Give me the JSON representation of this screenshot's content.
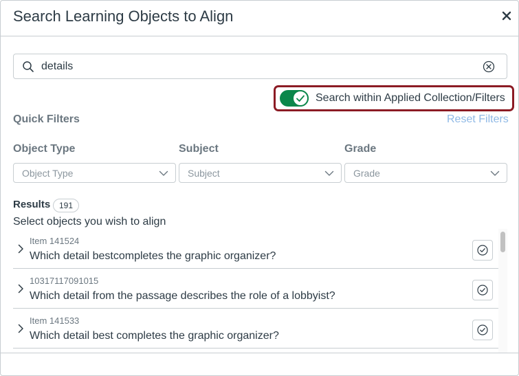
{
  "modal": {
    "title": "Search Learning Objects to Align",
    "close_icon": "close-icon"
  },
  "search": {
    "value": "details",
    "placeholder": "",
    "icon": "search-icon",
    "clear_icon": "clear-circle-icon"
  },
  "toggle": {
    "label": "Search within Applied Collection/Filters",
    "checked": true,
    "on_color": "#0b874b",
    "highlight_color": "#8c1b24"
  },
  "quick_filters": {
    "title": "Quick Filters",
    "reset_label": "Reset Filters",
    "filters": [
      {
        "label": "Object Type",
        "placeholder": "Object Type"
      },
      {
        "label": "Subject",
        "placeholder": "Subject"
      },
      {
        "label": "Grade",
        "placeholder": "Grade"
      }
    ]
  },
  "results": {
    "label": "Results",
    "count": "191",
    "instruction": "Select objects you wish to align",
    "items": [
      {
        "id": "Item 141524",
        "text": "Which detail bestcompletes the graphic organizer?"
      },
      {
        "id": "10317117091015",
        "text": "Which detail from the passage describes the role of a lobbyist?"
      },
      {
        "id": "Item 141533",
        "text": "Which detail best completes the graphic organizer?"
      }
    ]
  }
}
